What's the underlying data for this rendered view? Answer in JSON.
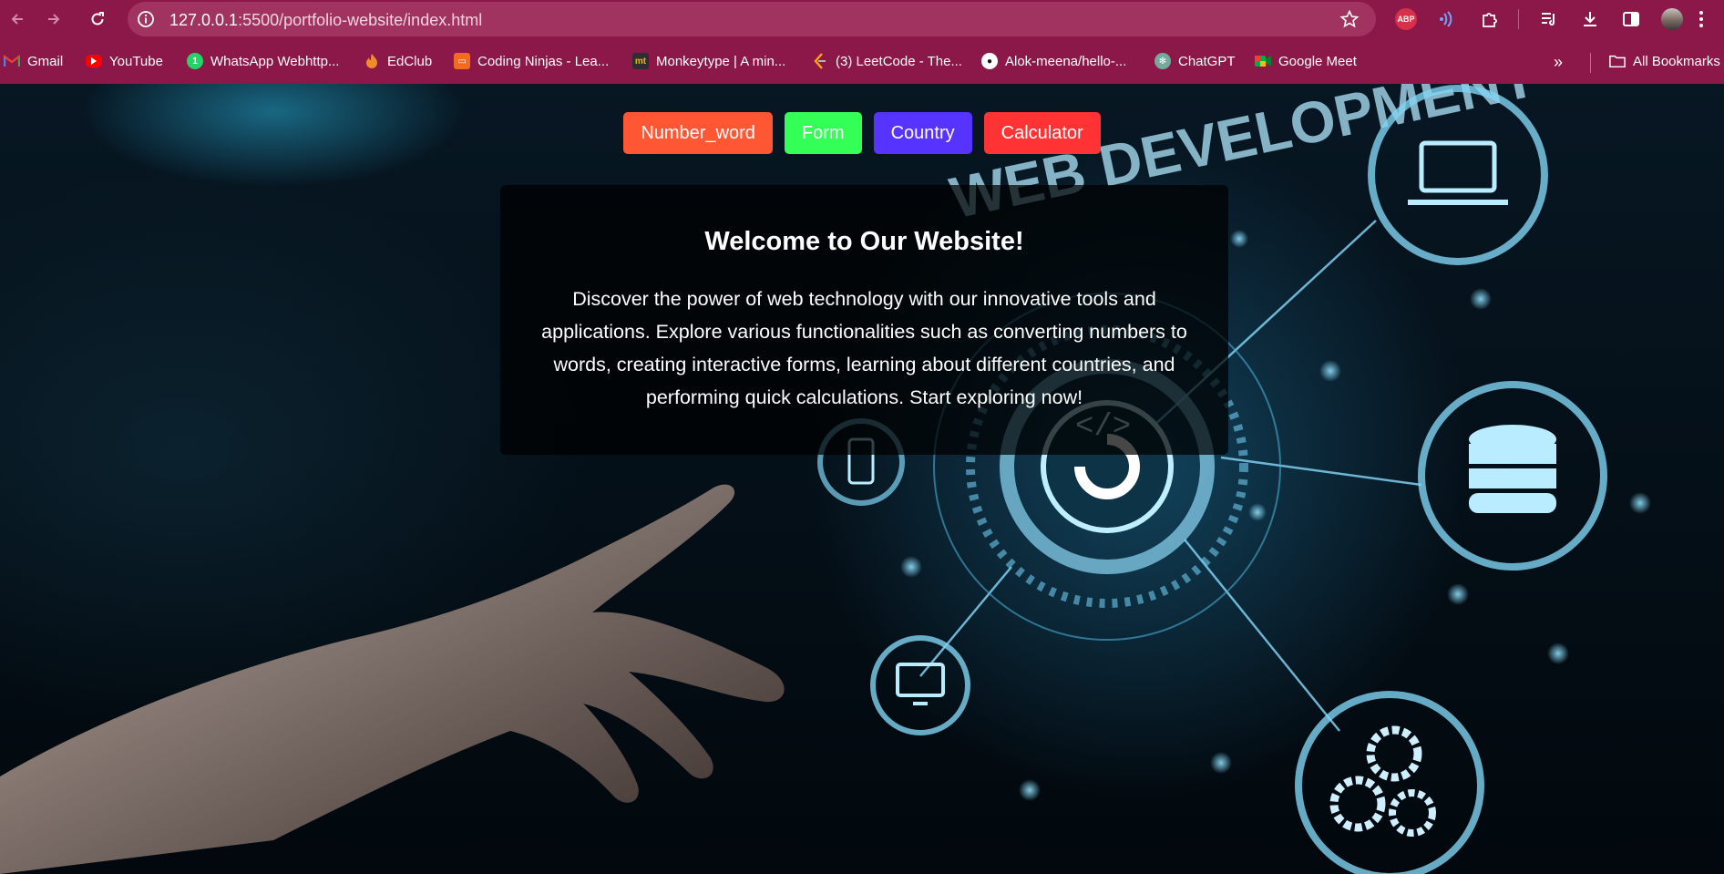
{
  "browser": {
    "url_host": "127.0.0.1",
    "url_path": ":5500/portfolio-website/index.html",
    "abp_label": "ABP",
    "bookmarks": [
      {
        "label": "Gmail",
        "icon": "gmail-icon",
        "color": "#ea4335"
      },
      {
        "label": "YouTube",
        "icon": "youtube-icon",
        "color": "#ff0000"
      },
      {
        "label": "WhatsApp Webhttp...",
        "icon": "whatsapp-icon",
        "color": "#25d366"
      },
      {
        "label": "EdClub",
        "icon": "edclub-icon",
        "color": "#f28c28"
      },
      {
        "label": "Coding Ninjas - Lea...",
        "icon": "coding-ninjas-icon",
        "color": "#f36b21"
      },
      {
        "label": "Monkeytype | A min...",
        "icon": "monkeytype-icon",
        "color": "#2c2e31"
      },
      {
        "label": "(3) LeetCode - The...",
        "icon": "leetcode-icon",
        "color": "#ffa116"
      },
      {
        "label": "Alok-meena/hello-...",
        "icon": "github-icon",
        "color": "#ffffff"
      },
      {
        "label": "ChatGPT",
        "icon": "chatgpt-icon",
        "color": "#74aa9c"
      },
      {
        "label": "Google Meet",
        "icon": "google-meet-icon",
        "color": "#00ac47"
      }
    ],
    "all_bookmarks_label": "All Bookmarks",
    "chrome_color": "#8b1848"
  },
  "page": {
    "nav": [
      {
        "label": "Number_word",
        "color": "#ff5733"
      },
      {
        "label": "Form",
        "color": "#33ff57"
      },
      {
        "label": "Country",
        "color": "#5733ff"
      },
      {
        "label": "Calculator",
        "color": "#ff3333"
      }
    ],
    "welcome": {
      "title": "Welcome to Our Website!",
      "body": "Discover the power of web technology with our innovative tools and applications. Explore various functionalities such as converting numbers to words, creating interactive forms, learning about different countries, and performing quick calculations. Start exploring now!"
    },
    "background_text": "WEB DEVELOPMENT"
  }
}
